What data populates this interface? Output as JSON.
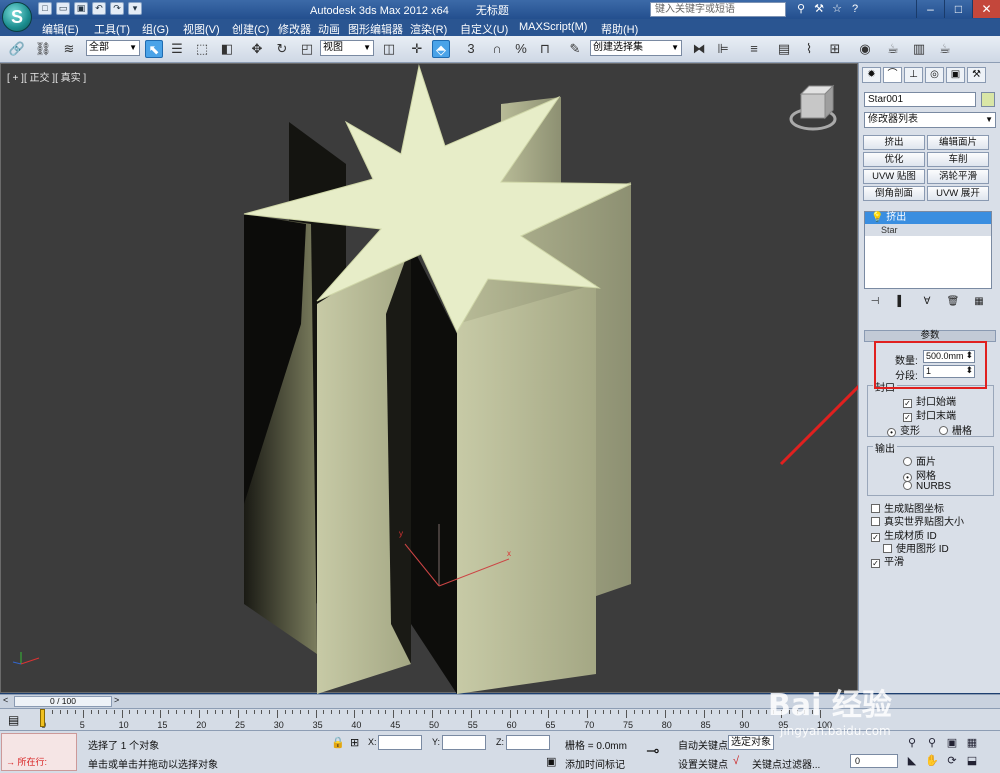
{
  "title": {
    "app": "Autodesk 3ds Max  2012 x64",
    "file": "无标题",
    "search_placeholder": "键入关键字或短语"
  },
  "app_button": "S",
  "menu": [
    "编辑(E)",
    "工具(T)",
    "组(G)",
    "视图(V)",
    "创建(C)",
    "修改器",
    "动画",
    "图形编辑器",
    "渲染(R)",
    "自定义(U)",
    "MAXScript(M)",
    "帮助(H)"
  ],
  "toolbar": {
    "selection_filter": "全部",
    "ref_coord": "视图",
    "named_selection": "创建选择集"
  },
  "viewport": {
    "label": "[ + ][ 正交 ][ 真实 ]",
    "axis_x": "x",
    "axis_y": "y"
  },
  "command_panel": {
    "object_name": "Star001",
    "modifier_list": "修改器列表",
    "modifier_buttons": [
      "挤出",
      "编辑面片",
      "优化",
      "车削",
      "UVW 贴图",
      "涡轮平滑",
      "倒角剖面",
      "UVW 展开"
    ],
    "stack": [
      "挤出",
      "Star"
    ],
    "rollout_title": "参数",
    "amount_label": "数量:",
    "amount_value": "500.0mm",
    "segments_label": "分段:",
    "segments_value": "1",
    "capping_title": "封口",
    "cap_start": "封口始端",
    "cap_end": "封口末端",
    "morph": "变形",
    "grid": "栅格",
    "output_title": "输出",
    "out_patch": "面片",
    "out_mesh": "网格",
    "out_nurbs": "NURBS",
    "gen_map_coords": "生成贴图坐标",
    "real_world": "真实世界贴图大小",
    "gen_mat_ids": "生成材质 ID",
    "use_shape_ids": "使用图形 ID",
    "smooth": "平滑"
  },
  "timeline": {
    "frame_display": "0 / 100",
    "ticks": [
      "0",
      "5",
      "10",
      "15",
      "20",
      "25",
      "30",
      "35",
      "40",
      "45",
      "50",
      "55",
      "60",
      "65",
      "70",
      "75",
      "80",
      "85",
      "90",
      "95",
      "100"
    ]
  },
  "status": {
    "maxscript_label": "所在行:",
    "selected": "选择了 1 个对象",
    "prompt": "单击或单击并拖动以选择对象",
    "x_label": "X:",
    "y_label": "Y:",
    "z_label": "Z:",
    "grid": "栅格 = 0.0mm",
    "add_time_tag": "添加时间标记",
    "auto_key": "自动关键点",
    "set_key": "设置关键点",
    "selected_obj": "选定对象",
    "key_filters": "关键点过滤器...",
    "frame": "0"
  },
  "watermark": "Bai 经验",
  "watermark_url": "jingyan.baidu.com"
}
